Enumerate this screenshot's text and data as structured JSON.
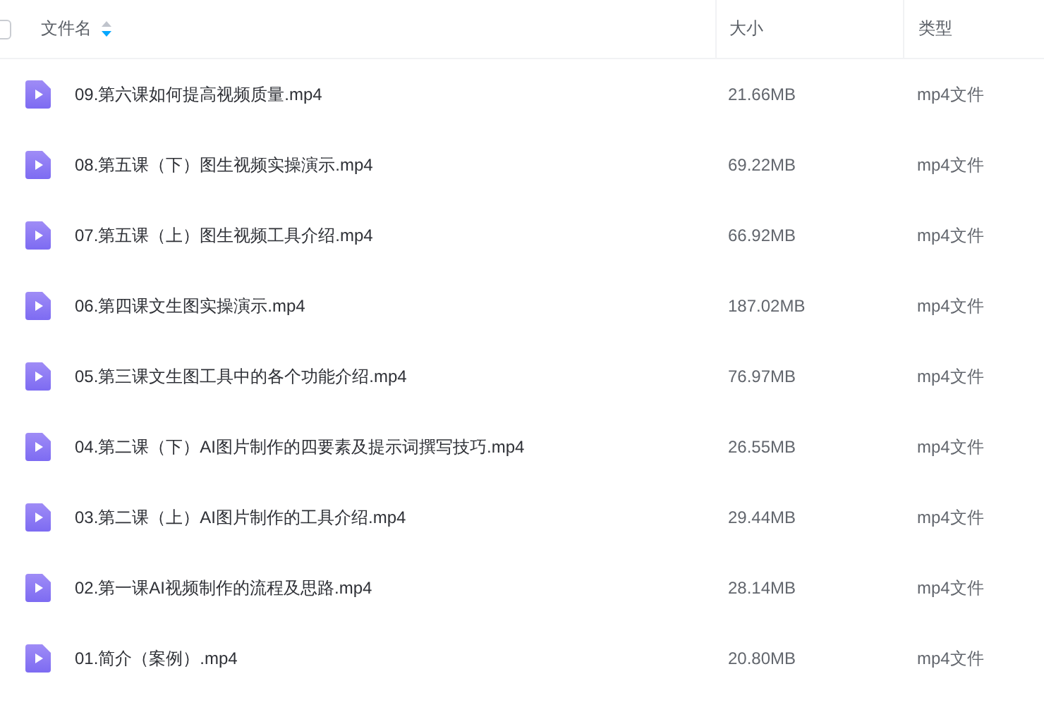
{
  "header": {
    "select_all": {
      "checked": false
    },
    "columns": [
      "文件名",
      "大小",
      "类型"
    ]
  },
  "files": [
    {
      "name": "09.第六课如何提高视频质量.mp4",
      "size": "21.66MB",
      "type": "mp4文件"
    },
    {
      "name": "08.第五课（下）图生视频实操演示.mp4",
      "size": "69.22MB",
      "type": "mp4文件"
    },
    {
      "name": "07.第五课（上）图生视频工具介绍.mp4",
      "size": "66.92MB",
      "type": "mp4文件"
    },
    {
      "name": "06.第四课文生图实操演示.mp4",
      "size": "187.02MB",
      "type": "mp4文件"
    },
    {
      "name": "05.第三课文生图工具中的各个功能介绍.mp4",
      "size": "76.97MB",
      "type": "mp4文件"
    },
    {
      "name": "04.第二课（下）AI图片制作的四要素及提示词撰写技巧.mp4",
      "size": "26.55MB",
      "type": "mp4文件"
    },
    {
      "name": "03.第二课（上）AI图片制作的工具介绍.mp4",
      "size": "29.44MB",
      "type": "mp4文件"
    },
    {
      "name": "02.第一课AI视频制作的流程及思路.mp4",
      "size": "28.14MB",
      "type": "mp4文件"
    },
    {
      "name": "01.简介（案例）.mp4",
      "size": "20.80MB",
      "type": "mp4文件"
    }
  ]
}
